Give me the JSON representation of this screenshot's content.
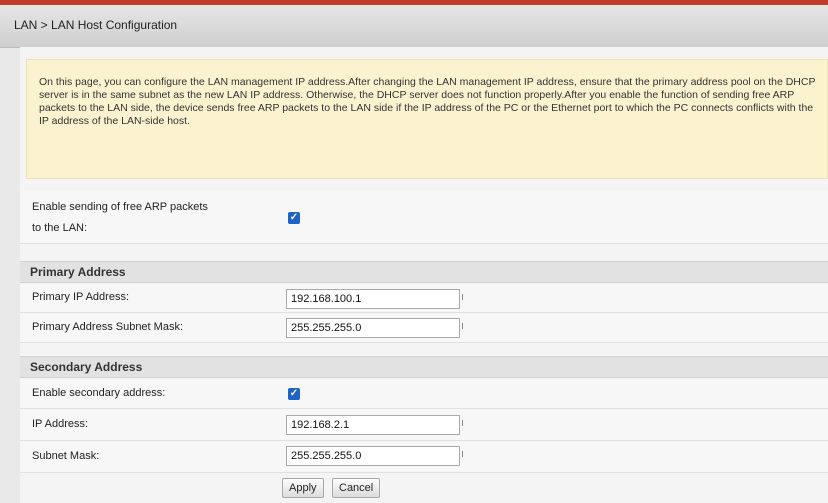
{
  "header": {
    "breadcrumb": "LAN > LAN Host Configuration"
  },
  "notice": {
    "text": "On this page, you can configure the LAN management IP address.After changing the LAN management IP address, ensure that the primary address pool on the DHCP server is in the same subnet as the new LAN IP address. Otherwise, the DHCP server does not function properly.After you enable the function of sending free ARP packets to the LAN side, the device sends free ARP packets to the LAN side if the IP address of the PC or the Ethernet port to which the PC connects conflicts with the IP address of the LAN-side host."
  },
  "arp": {
    "label_line1": "Enable sending of free ARP packets",
    "label_line2": "to the LAN:",
    "checked": true
  },
  "primary": {
    "title": "Primary Address",
    "ip_label": "Primary IP Address:",
    "ip_value": "192.168.100.1",
    "mask_label": "Primary Address Subnet Mask:",
    "mask_value": "255.255.255.0"
  },
  "secondary": {
    "title": "Secondary Address",
    "enable_label": "Enable secondary address:",
    "enabled": true,
    "ip_label": "IP Address:",
    "ip_value": "192.168.2.1",
    "mask_label": "Subnet Mask:",
    "mask_value": "255.255.255.0"
  },
  "buttons": {
    "apply": "Apply",
    "cancel": "Cancel"
  },
  "colors": {
    "accent_line": "#c0392b",
    "checkbox": "#1f63c6",
    "notice_bg": "#fbf3cf"
  },
  "icons": {
    "check": "check-icon"
  }
}
